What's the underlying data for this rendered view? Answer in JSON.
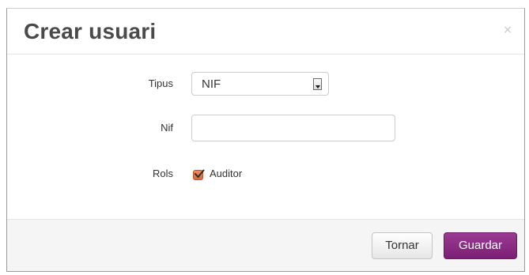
{
  "modal": {
    "title": "Crear usuari",
    "close_symbol": "×"
  },
  "form": {
    "tipus": {
      "label": "Tipus",
      "selected": "NIF"
    },
    "nif": {
      "label": "Nif",
      "value": ""
    },
    "rols": {
      "label": "Rols",
      "options": [
        {
          "label": "Auditor",
          "checked": true
        }
      ]
    }
  },
  "footer": {
    "back_label": "Tornar",
    "save_label": "Guardar"
  },
  "colors": {
    "primary": "#7f2279",
    "checkbox": "#e07845"
  },
  "icons": {
    "close": "close-icon",
    "select_arrow": "chevron-down-icon",
    "checkbox": "check-icon"
  }
}
